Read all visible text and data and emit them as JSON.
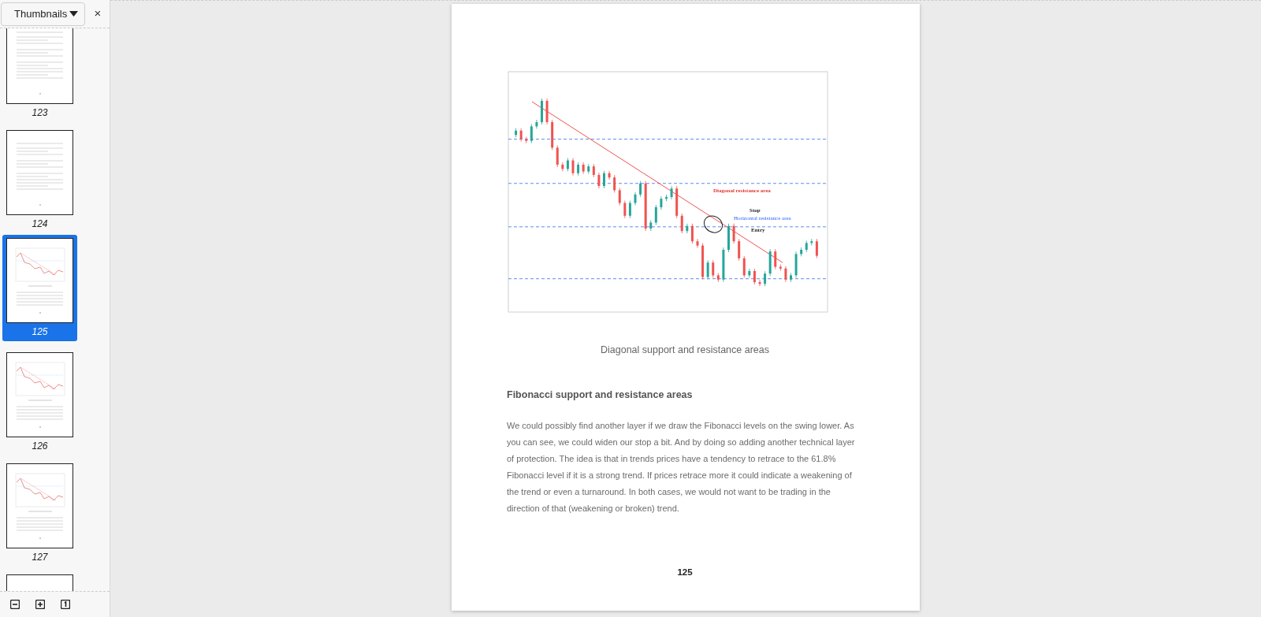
{
  "sidebar": {
    "view_selector": "Thumbnails",
    "close": "×",
    "thumbnails": [
      {
        "page": "123",
        "kind": "text",
        "selected": false
      },
      {
        "page": "124",
        "kind": "text",
        "selected": false
      },
      {
        "page": "125",
        "kind": "chart",
        "selected": true
      },
      {
        "page": "126",
        "kind": "chart",
        "selected": false
      },
      {
        "page": "127",
        "kind": "chart",
        "selected": false
      }
    ]
  },
  "document": {
    "chart_annotations": [
      {
        "kind": "diagonal",
        "text": "Diagonal resistance area"
      },
      {
        "kind": "stop",
        "text": "Stop"
      },
      {
        "kind": "horizontal",
        "text": "Horizontal resistance area"
      },
      {
        "kind": "entry",
        "text": "Entry"
      }
    ],
    "caption": "Diagonal support and resistance areas",
    "heading": "Fibonacci support and resistance areas",
    "paragraph": "We could possibly find another layer if we draw the Fibonacci levels on the swing lower. As you can see, we could widen our stop a bit. And by doing so adding another technical layer of protection. The idea is that in trends prices have a tendency to retrace to the 61.8% Fibonacci level if it is a strong trend. If prices retrace more it could indicate a weakening of the trend or even a turnaround. In both cases, we would not want to be trading in the direction of that (weakening or broken) trend.",
    "page_number": "125"
  }
}
